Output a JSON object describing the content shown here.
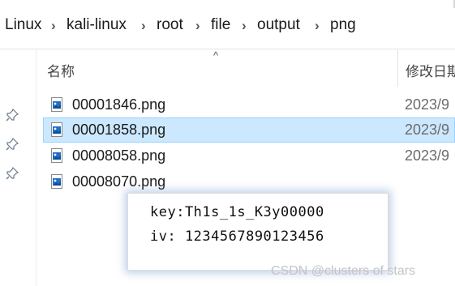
{
  "breadcrumb": {
    "items": [
      {
        "label": "Linux"
      },
      {
        "label": "kali-linux"
      },
      {
        "label": "root"
      },
      {
        "label": "file"
      },
      {
        "label": "output"
      },
      {
        "label": "png"
      }
    ]
  },
  "columns": {
    "name": "名称",
    "date": "修改日期"
  },
  "files": [
    {
      "name": "00001846.png",
      "date": "2023/9",
      "selected": false
    },
    {
      "name": "00001858.png",
      "date": "2023/9",
      "selected": true
    },
    {
      "name": "00008058.png",
      "date": "2023/9",
      "selected": false
    },
    {
      "name": "00008070.png",
      "date": "",
      "selected": false
    }
  ],
  "popup": {
    "key_line": "key:Th1s_1s_K3y00000",
    "iv_line": "iv: 1234567890123456"
  },
  "watermark": "CSDN @clusters of stars",
  "colors": {
    "selected_bg": "#cce8ff",
    "selected_border": "#99d1ff",
    "popup_glow": "#6e96c8"
  }
}
